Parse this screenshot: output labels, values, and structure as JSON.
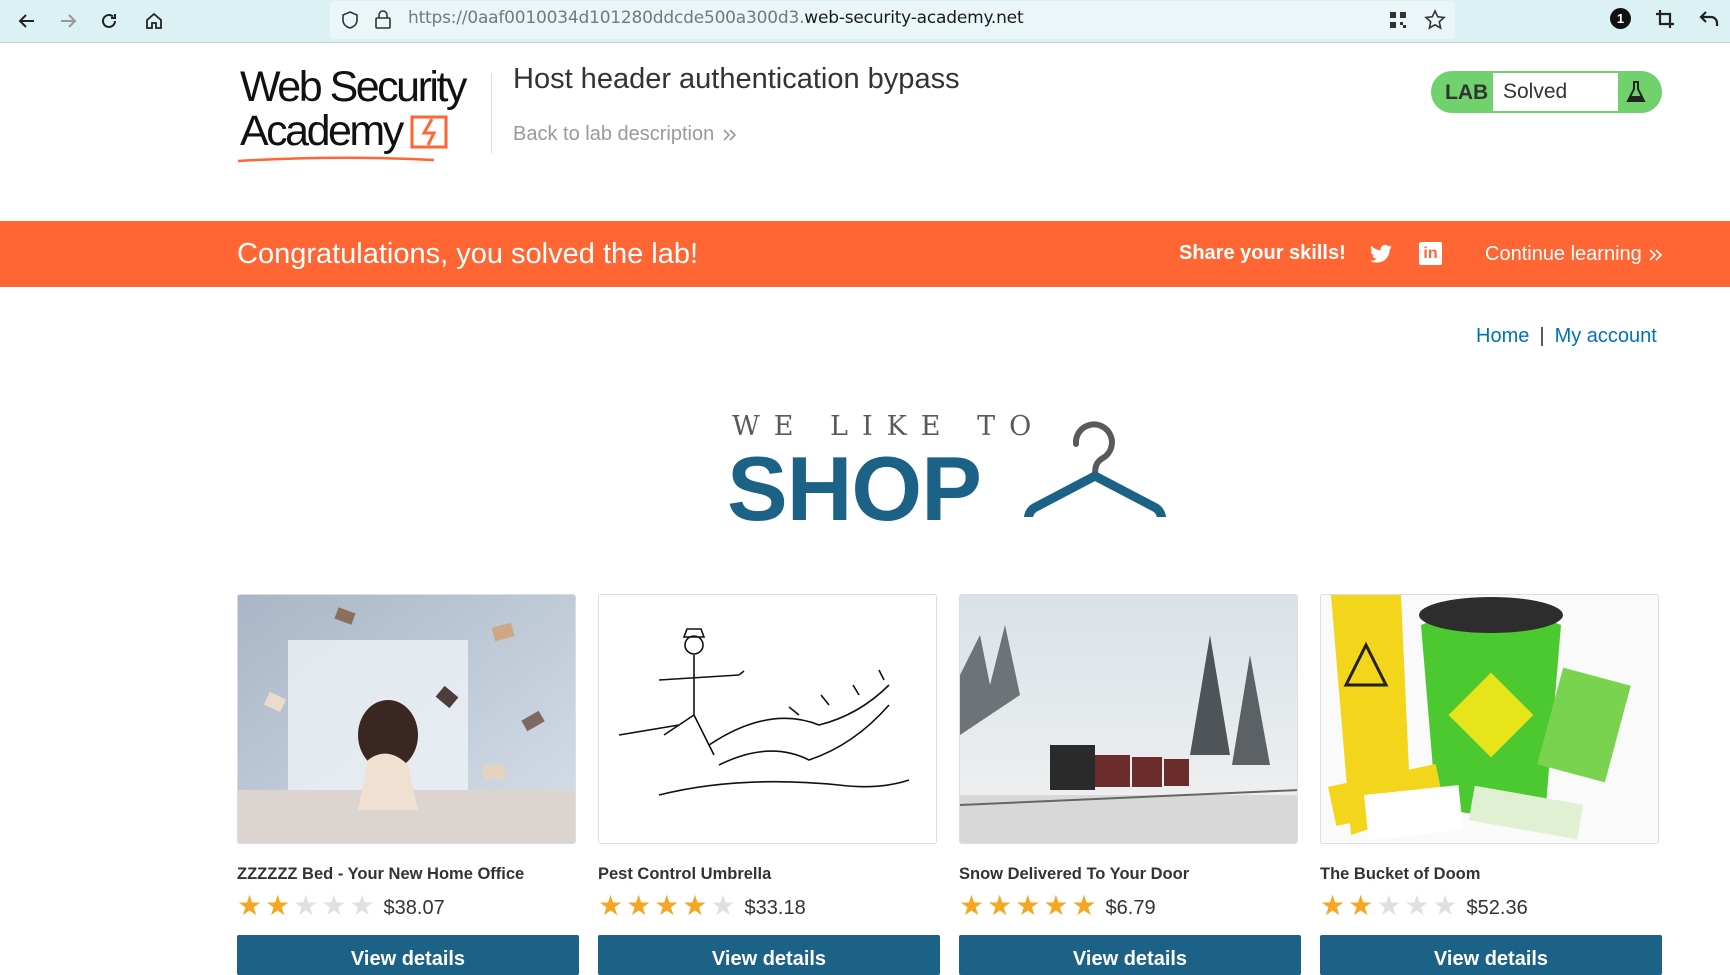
{
  "browser": {
    "url_prefix": "https://0aaf0010034d101280ddcde500a300d3.",
    "url_host": "web-security-academy.net",
    "badge_count": "1"
  },
  "header": {
    "logo_line1": "Web Security",
    "logo_line2": "Academy",
    "lab_title": "Host header authentication bypass",
    "back_link": "Back to lab description",
    "lab_label": "LAB",
    "lab_status": "Solved"
  },
  "banner": {
    "congrats": "Congratulations, you solved the lab!",
    "share": "Share your skills!",
    "linkedin_label": "in",
    "continue": "Continue learning"
  },
  "nav": {
    "home": "Home",
    "separator": "|",
    "account": "My account"
  },
  "shop_logo": {
    "small": "WE LIKE TO",
    "big": "SHOP"
  },
  "products": [
    {
      "name": "ZZZZZZ Bed - Your New Home Office",
      "rating": 2,
      "price": "$38.07",
      "button": "View details"
    },
    {
      "name": "Pest Control Umbrella",
      "rating": 4,
      "price": "$33.18",
      "button": "View details"
    },
    {
      "name": "Snow Delivered To Your Door",
      "rating": 5,
      "price": "$6.79",
      "button": "View details"
    },
    {
      "name": "The Bucket of Doom",
      "rating": 2,
      "price": "$52.36",
      "button": "View details"
    }
  ],
  "colors": {
    "brand_orange": "#ff6633",
    "shop_blue": "#1c6286",
    "link_blue": "#0071bc",
    "solved_green": "#70d16d",
    "star_gold": "#f5a623"
  }
}
